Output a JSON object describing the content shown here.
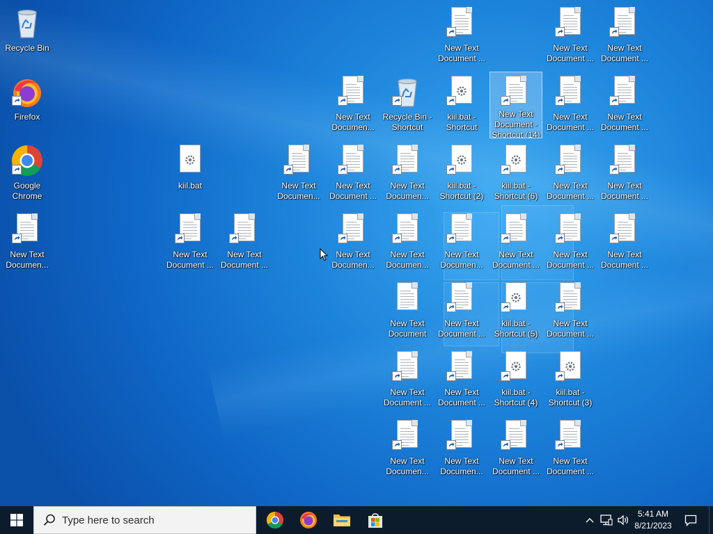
{
  "desktop": {
    "icons": [
      {
        "name": "recycle-bin-icon",
        "type": "recycle-bin",
        "label": "Recycle Bin",
        "shortcut": false,
        "selected": false
      },
      {
        "name": "firefox-shortcut",
        "type": "firefox",
        "label": "Firefox",
        "shortcut": true,
        "selected": false
      },
      {
        "name": "google-chrome-shortcut",
        "type": "chrome",
        "label": "Google\nChrome",
        "shortcut": true,
        "selected": false
      },
      {
        "name": "text-document-shortcut",
        "type": "document",
        "label": "New Text\nDocumen...",
        "shortcut": true,
        "selected": false
      },
      {
        "name": "kiil-bat-file",
        "type": "batch",
        "label": "kiil.bat",
        "shortcut": false,
        "selected": false
      },
      {
        "name": "text-document-shortcut",
        "type": "document",
        "label": "New Text\nDocument ...",
        "shortcut": true,
        "selected": false
      },
      {
        "name": "text-document-shortcut",
        "type": "document",
        "label": "New Text\nDocument ...",
        "shortcut": true,
        "selected": false
      },
      {
        "name": "text-document-shortcut",
        "type": "document",
        "label": "New Text\nDocumen...",
        "shortcut": true,
        "selected": false
      },
      {
        "name": "text-document-shortcut",
        "type": "document",
        "label": "New Text\nDocumen...",
        "shortcut": true,
        "selected": false
      },
      {
        "name": "text-document-shortcut",
        "type": "document",
        "label": "New Text\nDocument ...",
        "shortcut": true,
        "selected": false
      },
      {
        "name": "text-document-shortcut",
        "type": "document",
        "label": "New Text\nDocumen...",
        "shortcut": true,
        "selected": false
      },
      {
        "name": "recycle-bin-shortcut",
        "type": "recycle-bin",
        "label": "Recycle Bin -\nShortcut",
        "shortcut": true,
        "selected": false
      },
      {
        "name": "text-document-shortcut",
        "type": "document",
        "label": "New Text\nDocumen...",
        "shortcut": true,
        "selected": false
      },
      {
        "name": "text-document-shortcut",
        "type": "document",
        "label": "New Text\nDocumen...",
        "shortcut": true,
        "selected": false
      },
      {
        "name": "text-document-file",
        "type": "document",
        "label": "New Text\nDocument",
        "shortcut": false,
        "selected": false
      },
      {
        "name": "text-document-shortcut",
        "type": "document",
        "label": "New Text\nDocument ...",
        "shortcut": true,
        "selected": false
      },
      {
        "name": "text-document-shortcut",
        "type": "document",
        "label": "New Text\nDocumen...",
        "shortcut": true,
        "selected": false
      },
      {
        "name": "text-document-shortcut",
        "type": "document",
        "label": "New Text\nDocument ...",
        "shortcut": true,
        "selected": false
      },
      {
        "name": "kiil-bat-shortcut",
        "type": "batch",
        "label": "kiil.bat -\nShortcut",
        "shortcut": true,
        "selected": false
      },
      {
        "name": "kiil-bat-shortcut",
        "type": "batch",
        "label": "kiil.bat -\nShortcut (2)",
        "shortcut": true,
        "selected": false
      },
      {
        "name": "text-document-shortcut",
        "type": "document",
        "label": "New Text\nDocumen...",
        "shortcut": true,
        "selected": false
      },
      {
        "name": "text-document-shortcut",
        "type": "document",
        "label": "New Text\nDocument ...",
        "shortcut": true,
        "selected": false
      },
      {
        "name": "text-document-shortcut",
        "type": "document",
        "label": "New Text\nDocument ...",
        "shortcut": true,
        "selected": false
      },
      {
        "name": "text-document-shortcut",
        "type": "document",
        "label": "New Text\nDocumen...",
        "shortcut": true,
        "selected": false
      },
      {
        "name": "text-document-shortcut",
        "type": "document",
        "label": "New Text\nDocument -\nShortcut (14)",
        "shortcut": true,
        "selected": true
      },
      {
        "name": "kiil-bat-shortcut",
        "type": "batch",
        "label": "kiil.bat -\nShortcut (6)",
        "shortcut": true,
        "selected": false
      },
      {
        "name": "text-document-shortcut",
        "type": "document",
        "label": "New Text\nDocument ...",
        "shortcut": true,
        "selected": false
      },
      {
        "name": "kiil-bat-shortcut",
        "type": "batch",
        "label": "kiil.bat -\nShortcut (5)",
        "shortcut": true,
        "selected": false
      },
      {
        "name": "kiil-bat-shortcut",
        "type": "batch",
        "label": "kiil.bat -\nShortcut (4)",
        "shortcut": true,
        "selected": false
      },
      {
        "name": "text-document-shortcut",
        "type": "document",
        "label": "New Text\nDocument ...",
        "shortcut": true,
        "selected": false
      },
      {
        "name": "text-document-shortcut",
        "type": "document",
        "label": "New Text\nDocument ...",
        "shortcut": true,
        "selected": false
      },
      {
        "name": "text-document-shortcut",
        "type": "document",
        "label": "New Text\nDocument ...",
        "shortcut": true,
        "selected": false
      },
      {
        "name": "text-document-shortcut",
        "type": "document",
        "label": "New Text\nDocument ...",
        "shortcut": true,
        "selected": false
      },
      {
        "name": "text-document-shortcut",
        "type": "document",
        "label": "New Text\nDocument ...",
        "shortcut": true,
        "selected": false
      },
      {
        "name": "text-document-shortcut",
        "type": "document",
        "label": "New Text\nDocument ...",
        "shortcut": true,
        "selected": false
      },
      {
        "name": "kiil-bat-shortcut",
        "type": "batch",
        "label": "kiil.bat -\nShortcut (3)",
        "shortcut": true,
        "selected": false
      },
      {
        "name": "text-document-shortcut",
        "type": "document",
        "label": "New Text\nDocument ...",
        "shortcut": true,
        "selected": false
      },
      {
        "name": "text-document-shortcut",
        "type": "document",
        "label": "New Text\nDocument ...",
        "shortcut": true,
        "selected": false
      },
      {
        "name": "text-document-shortcut",
        "type": "document",
        "label": "New Text\nDocument ...",
        "shortcut": true,
        "selected": false
      },
      {
        "name": "text-document-shortcut",
        "type": "document",
        "label": "New Text\nDocument ...",
        "shortcut": true,
        "selected": false
      },
      {
        "name": "text-document-shortcut",
        "type": "document",
        "label": "New Text\nDocument ...",
        "shortcut": true,
        "selected": false
      }
    ]
  },
  "taskbar": {
    "start_icon": "windows-logo-icon",
    "search": {
      "placeholder": "Type here to search",
      "icon": "search-icon"
    },
    "pinned_apps": [
      {
        "name": "Google Chrome",
        "icon": "chrome-icon",
        "running": false
      },
      {
        "name": "Firefox",
        "icon": "firefox-icon",
        "running": false
      },
      {
        "name": "File Explorer",
        "icon": "folder-icon",
        "running": false
      },
      {
        "name": "Microsoft Store",
        "icon": "store-icon",
        "running": false
      }
    ],
    "tray": {
      "icons": [
        "chevron-up-icon",
        "network-icon",
        "volume-icon"
      ],
      "time": "5:41 AM",
      "date": "8/21/2023",
      "notification_icon": "notification-icon"
    }
  }
}
